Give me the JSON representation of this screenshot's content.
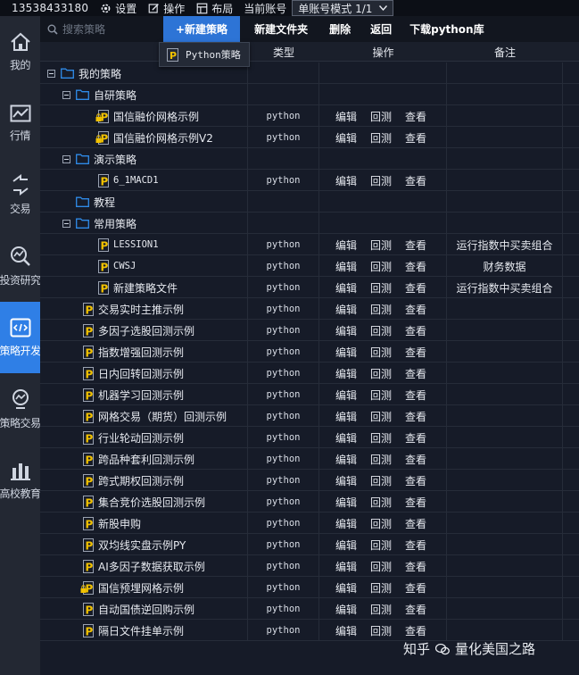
{
  "topbar": {
    "account": "13538433180",
    "menus": [
      {
        "label": "设置",
        "icon": "gear-icon"
      },
      {
        "label": "操作",
        "icon": "edit-icon"
      },
      {
        "label": "布局",
        "icon": "layout-icon"
      }
    ],
    "current_account_label": "当前账号",
    "mode_value": "单账号模式 1/1"
  },
  "sidebar": {
    "items": [
      {
        "label": "我的",
        "icon": "home-icon",
        "active": false
      },
      {
        "label": "行情",
        "icon": "market-chart-icon",
        "active": false
      },
      {
        "label": "交易",
        "icon": "trade-arrows-icon",
        "active": false
      },
      {
        "label": "投资研究",
        "icon": "research-icon",
        "active": false
      },
      {
        "label": "策略开发",
        "icon": "code-window-icon",
        "active": true
      },
      {
        "label": "策略交易",
        "icon": "strategy-trade-icon",
        "active": false
      },
      {
        "label": "高校教育",
        "icon": "education-icon",
        "active": false
      }
    ]
  },
  "toolbar": {
    "search_placeholder": "搜索策略",
    "new_strategy": "+新建策略",
    "new_folder": "新建文件夹",
    "delete": "删除",
    "back": "返回",
    "download_lib": "下载python库"
  },
  "dropdown": {
    "item": "Python策略"
  },
  "table": {
    "headers": {
      "type": "类型",
      "ops": "操作",
      "note": "备注"
    },
    "op_labels": {
      "edit": "编辑",
      "backtest": "回测",
      "view": "查看"
    },
    "rows": [
      {
        "kind": "folder",
        "level": 0,
        "name": "我的策略",
        "toggle": true,
        "type": "",
        "note": "",
        "mono": false,
        "lock": false
      },
      {
        "kind": "folder",
        "level": 1,
        "name": "自研策略",
        "toggle": true,
        "type": "",
        "note": "",
        "mono": false,
        "lock": false
      },
      {
        "kind": "file",
        "level": 2,
        "name": "国信融价网格示例",
        "type": "python",
        "note": "",
        "mono": false,
        "lock": true
      },
      {
        "kind": "file",
        "level": 2,
        "name": "国信融价网格示例V2",
        "type": "python",
        "note": "",
        "mono": false,
        "lock": true
      },
      {
        "kind": "folder",
        "level": 1,
        "name": "演示策略",
        "toggle": true,
        "type": "",
        "note": "",
        "mono": false,
        "lock": false
      },
      {
        "kind": "file",
        "level": 2,
        "name": "6_1MACD1",
        "type": "python",
        "note": "",
        "mono": true,
        "lock": false
      },
      {
        "kind": "folder",
        "level": 1,
        "name": "教程",
        "toggle": false,
        "type": "",
        "note": "",
        "mono": false,
        "lock": false
      },
      {
        "kind": "folder",
        "level": 1,
        "name": "常用策略",
        "toggle": true,
        "type": "",
        "note": "",
        "mono": false,
        "lock": false
      },
      {
        "kind": "file",
        "level": 2,
        "name": "LESSION1",
        "type": "python",
        "note": "运行指数中买卖组合",
        "mono": true,
        "lock": false
      },
      {
        "kind": "file",
        "level": 2,
        "name": "CWSJ",
        "type": "python",
        "note": "财务数据",
        "mono": true,
        "lock": false
      },
      {
        "kind": "file",
        "level": 2,
        "name": "新建策略文件",
        "type": "python",
        "note": "运行指数中买卖组合",
        "mono": false,
        "lock": false
      },
      {
        "kind": "file",
        "level": 1,
        "name": "交易实时主推示例",
        "type": "python",
        "note": "",
        "mono": false,
        "lock": false
      },
      {
        "kind": "file",
        "level": 1,
        "name": "多因子选股回测示例",
        "type": "python",
        "note": "",
        "mono": false,
        "lock": false
      },
      {
        "kind": "file",
        "level": 1,
        "name": "指数增强回测示例",
        "type": "python",
        "note": "",
        "mono": false,
        "lock": false
      },
      {
        "kind": "file",
        "level": 1,
        "name": "日内回转回测示例",
        "type": "python",
        "note": "",
        "mono": false,
        "lock": false
      },
      {
        "kind": "file",
        "level": 1,
        "name": "机器学习回测示例",
        "type": "python",
        "note": "",
        "mono": false,
        "lock": false
      },
      {
        "kind": "file",
        "level": 1,
        "name": "网格交易（期货）回测示例",
        "type": "python",
        "note": "",
        "mono": false,
        "lock": false
      },
      {
        "kind": "file",
        "level": 1,
        "name": "行业轮动回测示例",
        "type": "python",
        "note": "",
        "mono": false,
        "lock": false
      },
      {
        "kind": "file",
        "level": 1,
        "name": "跨品种套利回测示例",
        "type": "python",
        "note": "",
        "mono": false,
        "lock": false
      },
      {
        "kind": "file",
        "level": 1,
        "name": "跨式期权回测示例",
        "type": "python",
        "note": "",
        "mono": false,
        "lock": false
      },
      {
        "kind": "file",
        "level": 1,
        "name": "集合竞价选股回测示例",
        "type": "python",
        "note": "",
        "mono": false,
        "lock": false
      },
      {
        "kind": "file",
        "level": 1,
        "name": "新股申购",
        "type": "python",
        "note": "",
        "mono": false,
        "lock": false
      },
      {
        "kind": "file",
        "level": 1,
        "name": "双均线实盘示例PY",
        "type": "python",
        "note": "",
        "mono": false,
        "lock": false
      },
      {
        "kind": "file",
        "level": 1,
        "name": "AI多因子数据获取示例",
        "type": "python",
        "note": "",
        "mono": false,
        "lock": false
      },
      {
        "kind": "file",
        "level": 1,
        "name": "国信预埋网格示例",
        "type": "python",
        "note": "",
        "mono": false,
        "lock": true
      },
      {
        "kind": "file",
        "level": 1,
        "name": "自动国债逆回购示例",
        "type": "python",
        "note": "",
        "mono": false,
        "lock": false
      },
      {
        "kind": "file",
        "level": 1,
        "name": "隔日文件挂单示例",
        "type": "python",
        "note": "",
        "mono": false,
        "lock": false
      }
    ]
  },
  "watermark": {
    "left": "知乎",
    "right": "量化美国之路"
  },
  "colors": {
    "accent": "#2f7fe6",
    "folder": "#2f8be8",
    "file_p": "#f2c200"
  }
}
